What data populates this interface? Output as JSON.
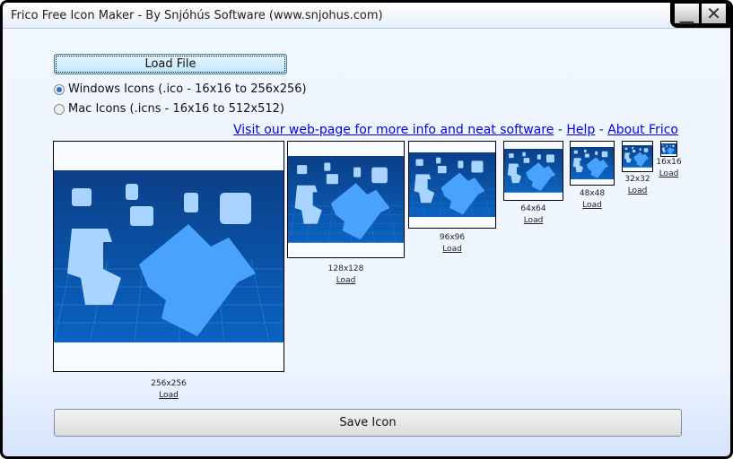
{
  "window": {
    "title": "Frico Free Icon Maker - By Snjóhús Software (www.snjohus.com)",
    "minimize": "▁",
    "close": "✕"
  },
  "load_file": "Load File",
  "formats": [
    {
      "label": "Windows Icons (.ico - 16x16 to 256x256)",
      "selected": true
    },
    {
      "label": "Mac Icons (.icns - 16x16 to 512x512)",
      "selected": false
    }
  ],
  "links": {
    "website": "Visit our web-page for more info and neat software",
    "sep": " - ",
    "help": "Help",
    "about": "About Frico"
  },
  "previews": [
    {
      "size": "256x256",
      "load": "Load"
    },
    {
      "size": "128x128",
      "load": "Load"
    },
    {
      "size": "96x96",
      "load": "Load"
    },
    {
      "size": "64x64",
      "load": "Load"
    },
    {
      "size": "48x48",
      "load": "Load"
    },
    {
      "size": "32x32",
      "load": "Load"
    },
    {
      "size": "16x16",
      "load": "Load"
    }
  ],
  "save_icon": "Save Icon"
}
